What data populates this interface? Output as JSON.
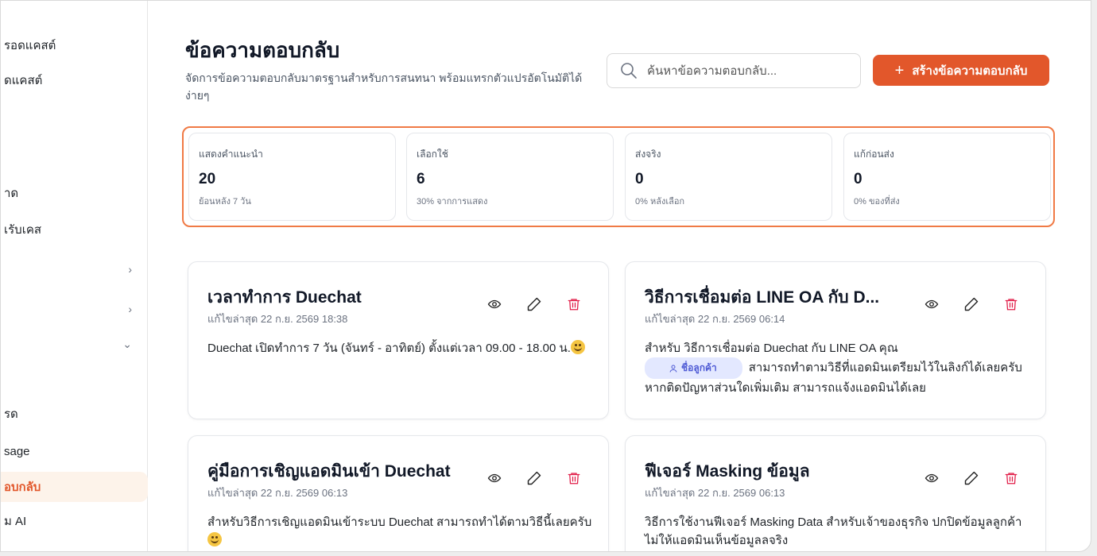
{
  "sidebar": {
    "items": [
      {
        "label": "รอดแคสต์"
      },
      {
        "label": "ดแคสต์"
      },
      {
        "label": "าด"
      },
      {
        "label": "เรับเคส"
      },
      {
        "label": ""
      },
      {
        "label": ""
      },
      {
        "label": ""
      },
      {
        "label": "รด"
      },
      {
        "label": "sage"
      },
      {
        "label": "อบกลับ"
      },
      {
        "label": "ม AI"
      }
    ],
    "chevrons": {
      "right": "›",
      "down": "⌄"
    }
  },
  "header": {
    "title": "ข้อความตอบกลับ",
    "subtitle": "จัดการข้อความตอบกลับมาตรฐานสำหรับการสนทนา พร้อมแทรกตัวแปรอัตโนมัติได้ง่ายๆ",
    "search_placeholder": "ค้นหาข้อความตอบกลับ...",
    "create_label": "สร้างข้อความตอบกลับ",
    "create_icon": "+"
  },
  "stats": [
    {
      "label": "แสดงคำแนะนำ",
      "value": "20",
      "note": "ย้อนหลัง 7 วัน"
    },
    {
      "label": "เลือกใช้",
      "value": "6",
      "note": "30% จากการแสดง"
    },
    {
      "label": "ส่งจริง",
      "value": "0",
      "note": "0% หลังเลือก"
    },
    {
      "label": "แก้ก่อนส่ง",
      "value": "0",
      "note": "0% ของที่ส่ง"
    }
  ],
  "cards": [
    {
      "title": "เวลาทำการ Duechat",
      "date": "แก้ไขล่าสุด 22 ก.ย. 2569 18:38",
      "body": "Duechat เปิดทำการ 7 วัน (จันทร์ - อาทิตย์) ตั้งแต่เวลา 09.00 - 18.00 น."
    },
    {
      "title": "วิธีการเชื่อมต่อ LINE OA กับ D...",
      "date": "แก้ไขล่าสุด 22 ก.ย. 2569 06:14",
      "body_before": "สำหรับ วิธีการเชื่อมต่อ Duechat กับ LINE OA คุณ",
      "chip": "ชื่อลูกค้า",
      "body_after": "สามารถทำตามวิธีที่แอดมินเตรียมไว้ในลิงก์ได้เลยครับ หากติดปัญหาส่วนใดเพิ่มเติม สามารถแจ้งแอดมินได้เลย"
    },
    {
      "title": "คู่มือการเชิญแอดมินเข้า Duechat",
      "date": "แก้ไขล่าสุด 22 ก.ย. 2569 06:13",
      "body": "สำหรับวิธีการเชิญแอดมินเข้าระบบ Duechat สามารถทำได้ตามวิธีนี้เลยครับ"
    },
    {
      "title": "ฟีเจอร์ Masking ข้อมูล",
      "date": "แก้ไขล่าสุด 22 ก.ย. 2569 06:13",
      "body": "วิธีการใช้งานฟีเจอร์ Masking Data สำหรับเจ้าของธุรกิจ ปกปิดข้อมูลลูกค้า ไม่ให้แอดมินเห็นข้อมูลลจริง"
    }
  ],
  "icons": {
    "view": "eye-icon",
    "edit": "pencil-icon",
    "delete": "trash-icon"
  },
  "colors": {
    "accent": "#e2572b",
    "delete": "#e11d48",
    "chip_bg": "#e3e8ff",
    "chip_text": "#4f5bd5"
  }
}
